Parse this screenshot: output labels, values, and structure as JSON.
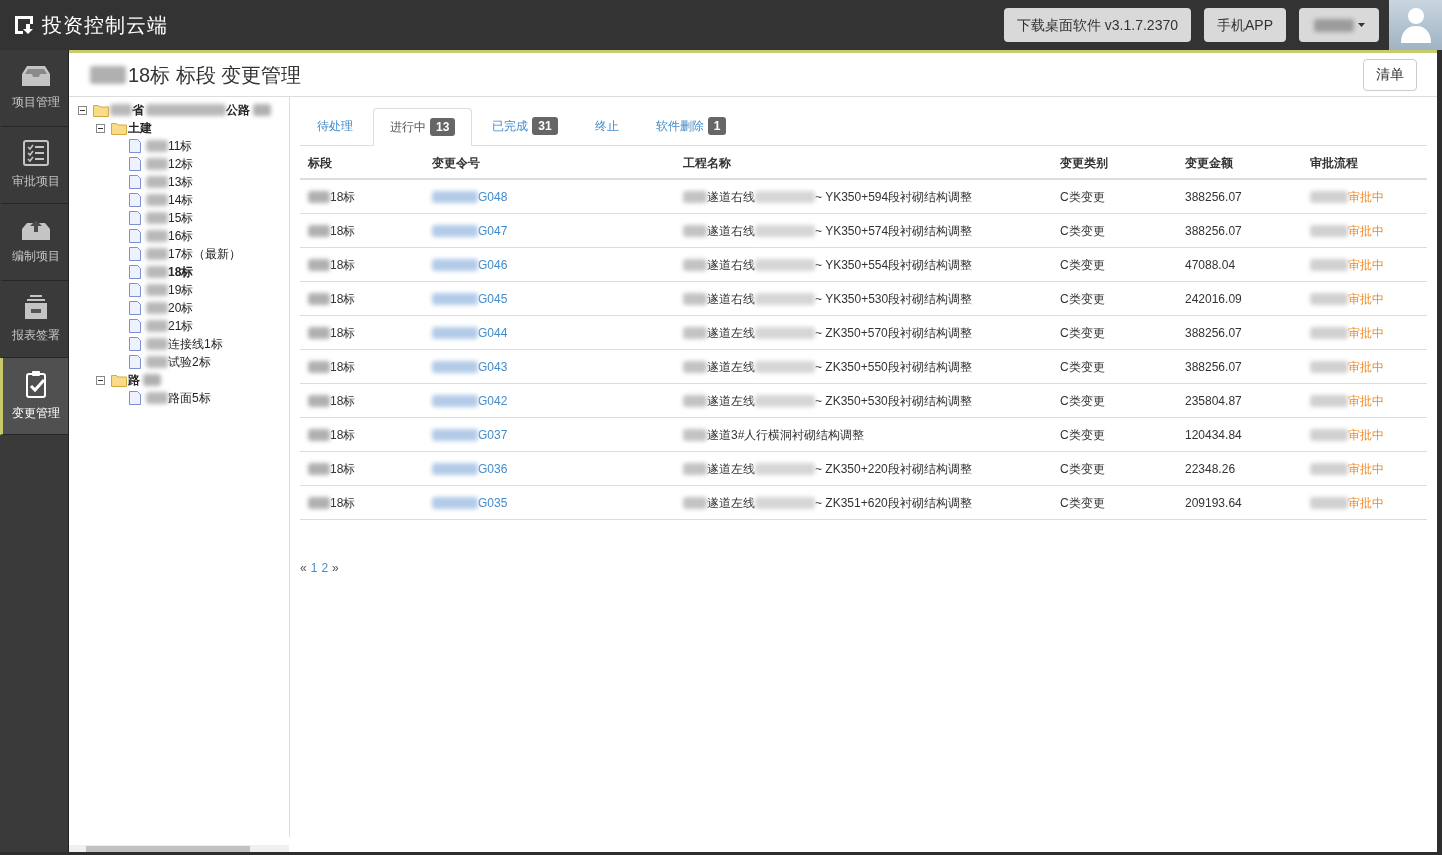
{
  "app": {
    "title": "投资控制云端"
  },
  "header": {
    "buttons": [
      {
        "label": "下载桌面软件 v3.1.7.2370"
      },
      {
        "label": "手机APP"
      }
    ],
    "user_menu": {
      "name_blurred": true
    }
  },
  "nav": [
    {
      "kind": "tray",
      "label": "项目管理",
      "selected": false
    },
    {
      "kind": "checklist",
      "label": "审批项目",
      "selected": false
    },
    {
      "kind": "upload",
      "label": "编制项目",
      "selected": false
    },
    {
      "kind": "cabinet",
      "label": "报表签署",
      "selected": false
    },
    {
      "kind": "clipboard",
      "label": "变更管理",
      "selected": true
    }
  ],
  "page": {
    "title": "18标 标段 变更管理",
    "blur_before": true,
    "action": "清单"
  },
  "tree": [
    {
      "parts": [
        "省",
        "公路"
      ],
      "blur_before": true,
      "blur_after": true,
      "expanded": true,
      "children": [
        {
          "parts": [
            "土建"
          ],
          "expanded": true,
          "children": [
            {
              "parts": [
                "11标"
              ],
              "blur_before": true,
              "selected": false
            },
            {
              "parts": [
                "12标"
              ],
              "blur_before": true,
              "selected": false
            },
            {
              "parts": [
                "13标"
              ],
              "blur_before": true,
              "selected": false
            },
            {
              "parts": [
                "14标"
              ],
              "blur_before": true,
              "selected": false
            },
            {
              "parts": [
                "15标"
              ],
              "blur_before": true,
              "selected": false
            },
            {
              "parts": [
                "16标"
              ],
              "blur_before": true,
              "selected": false
            },
            {
              "parts": [
                "17标（最新）"
              ],
              "blur_before": true,
              "selected": false
            },
            {
              "parts": [
                "18标"
              ],
              "blur_before": true,
              "selected": true
            },
            {
              "parts": [
                "19标"
              ],
              "blur_before": true,
              "selected": false
            },
            {
              "parts": [
                "20标"
              ],
              "blur_before": true,
              "selected": false
            },
            {
              "parts": [
                "21标"
              ],
              "blur_before": true,
              "selected": false
            },
            {
              "parts": [
                "连接线1标"
              ],
              "blur_before": true,
              "selected": false
            },
            {
              "parts": [
                "试验2标"
              ],
              "blur_before": true,
              "selected": false
            }
          ]
        },
        {
          "parts": [
            "路"
          ],
          "blur_after": true,
          "expanded": true,
          "children": [
            {
              "parts": [
                "路面5标"
              ],
              "blur_before": true,
              "selected": false
            }
          ]
        }
      ]
    }
  ],
  "tabs": [
    {
      "label": "待处理",
      "selected": false
    },
    {
      "label": "进行中",
      "count": "13",
      "selected": true
    },
    {
      "label": "已完成",
      "count": "31",
      "selected": false
    },
    {
      "label": "终止",
      "selected": false
    },
    {
      "label": "软件删除",
      "count": "1",
      "selected": false
    }
  ],
  "table": {
    "columns": [
      {
        "label": "标段",
        "kind": "text",
        "blur_before": true
      },
      {
        "label": "变更令号",
        "kind": "link",
        "blur_before": true
      },
      {
        "label": "工程名称",
        "kind": "parts",
        "blur_before": true
      },
      {
        "label": "变更类别",
        "kind": "text"
      },
      {
        "label": "变更金额",
        "kind": "text"
      },
      {
        "label": "审批流程",
        "kind": "status",
        "blur_before": true
      }
    ],
    "rows": [
      [
        "18标",
        "G048",
        [
          "遂道右线",
          "~ YK350+594段衬砌结构调整"
        ],
        "C类变更",
        "388256.07",
        "审批中"
      ],
      [
        "18标",
        "G047",
        [
          "遂道右线",
          "~ YK350+574段衬砌结构调整"
        ],
        "C类变更",
        "388256.07",
        "审批中"
      ],
      [
        "18标",
        "G046",
        [
          "遂道右线",
          "~ YK350+554段衬砌结构调整"
        ],
        "C类变更",
        "47088.04",
        "审批中"
      ],
      [
        "18标",
        "G045",
        [
          "遂道右线",
          "~ YK350+530段衬砌结构调整"
        ],
        "C类变更",
        "242016.09",
        "审批中"
      ],
      [
        "18标",
        "G044",
        [
          "遂道左线",
          "~ ZK350+570段衬砌结构调整"
        ],
        "C类变更",
        "388256.07",
        "审批中"
      ],
      [
        "18标",
        "G043",
        [
          "遂道左线",
          "~ ZK350+550段衬砌结构调整"
        ],
        "C类变更",
        "388256.07",
        "审批中"
      ],
      [
        "18标",
        "G042",
        [
          "遂道左线",
          "~ ZK350+530段衬砌结构调整"
        ],
        "C类变更",
        "235804.87",
        "审批中"
      ],
      [
        "18标",
        "G037",
        [
          "遂道3#人行横洞衬砌结构调整"
        ],
        "C类变更",
        "120434.84",
        "审批中"
      ],
      [
        "18标",
        "G036",
        [
          "遂道左线",
          "~ ZK350+220段衬砌结构调整"
        ],
        "C类变更",
        "22348.26",
        "审批中"
      ],
      [
        "18标",
        "G035",
        [
          "遂道左线",
          "~ ZK351+620段衬砌结构调整"
        ],
        "C类变更",
        "209193.64",
        "审批中"
      ]
    ]
  },
  "pagination": {
    "prev": "«",
    "pages": [
      "1",
      "2"
    ],
    "next": "»"
  }
}
